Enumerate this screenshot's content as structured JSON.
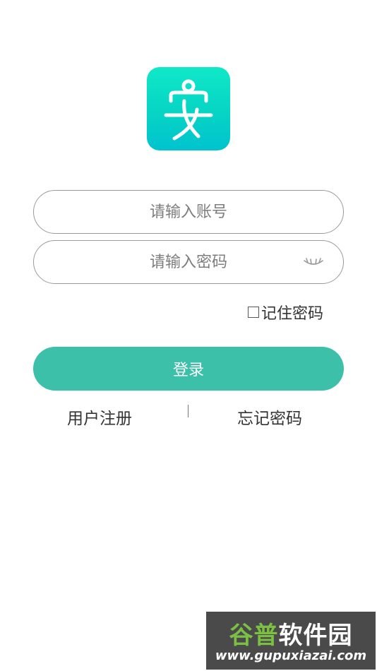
{
  "login": {
    "account_placeholder": "请输入账号",
    "password_placeholder": "请输入密码",
    "remember_label": "记住密码",
    "login_button": "登录",
    "register_link": "用户注册",
    "forgot_link": "忘记密码"
  },
  "logo": {
    "icon": "person-figure-icon"
  },
  "colors": {
    "primary": "#3cc0a9",
    "logo_gradient_top": "#10e8c8",
    "logo_gradient_bottom": "#00c3cf",
    "field_border": "#9a9a9a"
  },
  "watermark": {
    "logo_text_green": "谷普",
    "logo_text_white": "软件园",
    "url": "www.gupuxiazai.com"
  }
}
